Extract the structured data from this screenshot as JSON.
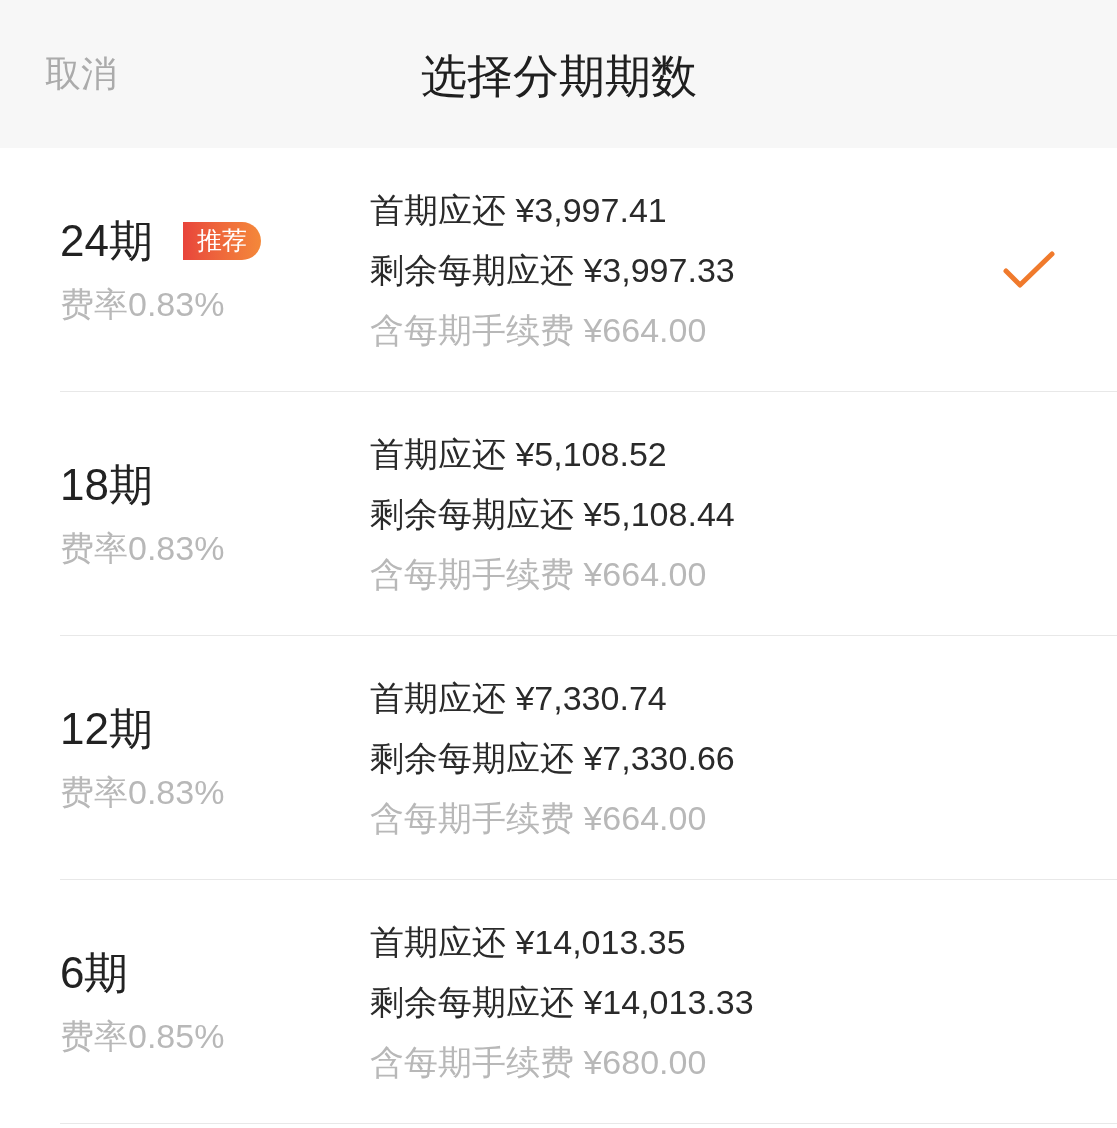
{
  "header": {
    "cancel": "取消",
    "title": "选择分期期数"
  },
  "plans": [
    {
      "periods": "24期",
      "badge": "推荐",
      "rate": "费率0.83%",
      "first_payment": "首期应还 ¥3,997.41",
      "remaining_payment": "剩余每期应还 ¥3,997.33",
      "fee": "含每期手续费 ¥664.00",
      "selected": true
    },
    {
      "periods": "18期",
      "rate": "费率0.83%",
      "first_payment": "首期应还 ¥5,108.52",
      "remaining_payment": "剩余每期应还 ¥5,108.44",
      "fee": "含每期手续费 ¥664.00",
      "selected": false
    },
    {
      "periods": "12期",
      "rate": "费率0.83%",
      "first_payment": "首期应还 ¥7,330.74",
      "remaining_payment": "剩余每期应还 ¥7,330.66",
      "fee": "含每期手续费 ¥664.00",
      "selected": false
    },
    {
      "periods": "6期",
      "rate": "费率0.85%",
      "first_payment": "首期应还 ¥14,013.35",
      "remaining_payment": "剩余每期应还 ¥14,013.33",
      "fee": "含每期手续费 ¥680.00",
      "selected": false
    }
  ]
}
